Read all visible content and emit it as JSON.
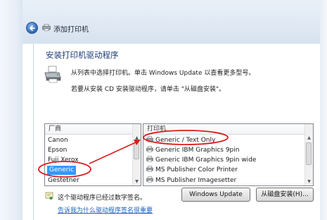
{
  "window": {
    "title": "添加打印机"
  },
  "main": {
    "heading": "安装打印机驱动程序",
    "desc_line1": "从列表中选择打印机。单击 Windows Update 以查看更多型号。",
    "desc_line2": "若要从安装 CD 安装驱动程序，请单击 \"从磁盘安装\"。"
  },
  "manufacturer_list": {
    "header": "厂商",
    "items": [
      "Canon",
      "Epson",
      "Fuji Xerox",
      "Generic",
      "Gestetner"
    ],
    "selected": "Generic"
  },
  "printer_list": {
    "header": "打印机",
    "items": [
      "Generic / Text Only",
      "Generic IBM Graphics 9pin",
      "Generic IBM Graphics 9pin wide",
      "MS Publisher Color Printer",
      "MS Publisher Imagesetter"
    ]
  },
  "footer": {
    "signed_text": "这个驱动程序已经过数字签名。",
    "signing_link": "告诉我为什么驱动程序签名很重要",
    "windows_update_button": "Windows Update",
    "have_disk_button": "从磁盘安装(H)..."
  },
  "colors": {
    "annotation": "#d81e1e",
    "selection": "#3399ff",
    "heading": "#1f3d7a"
  }
}
